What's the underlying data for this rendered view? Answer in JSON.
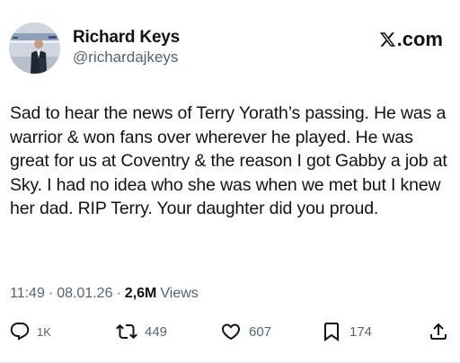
{
  "author": {
    "name": "Richard Keys",
    "handle": "@richardajkeys"
  },
  "brand": {
    "label": ".com",
    "icon": "x-logo-icon"
  },
  "tweet": {
    "text": "Sad to hear the news of Terry Yorath’s passing. He was a warrior & won fans over wherever he played. He was great for us at Coventry & the reason I got Gabby a job at Sky. I had no idea who she was when we met but I knew her dad. RIP Terry. Your daughter did you proud."
  },
  "meta": {
    "time": "11:49",
    "separator": "·",
    "date": "08.01.26",
    "views_count": "2,6M",
    "views_label": "Views"
  },
  "actions": {
    "reply": {
      "icon": "reply-icon",
      "count": "1K"
    },
    "repost": {
      "icon": "repost-icon",
      "count": "449"
    },
    "like": {
      "icon": "heart-icon",
      "count": "607"
    },
    "bookmark": {
      "icon": "bookmark-icon",
      "count": "174"
    },
    "share": {
      "icon": "share-icon"
    }
  },
  "colors": {
    "text": "#0f1419",
    "secondary": "#536471",
    "background": "#ffffff"
  }
}
